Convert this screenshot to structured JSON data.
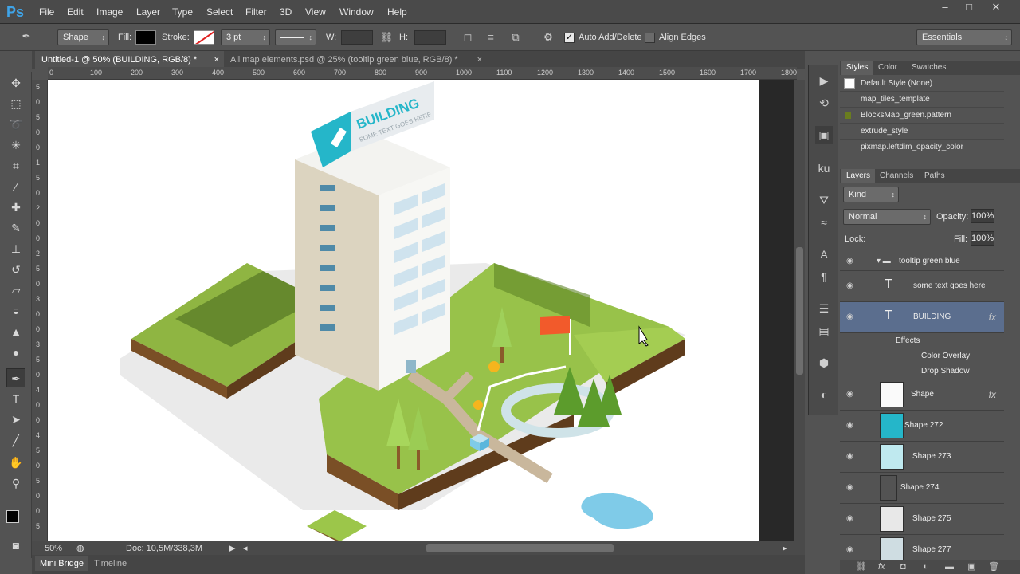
{
  "app": {
    "logo": "Ps"
  },
  "menu": [
    "File",
    "Edit",
    "Image",
    "Layer",
    "Type",
    "Select",
    "Filter",
    "3D",
    "View",
    "Window",
    "Help"
  ],
  "window_buttons": [
    "–",
    "□",
    "✕"
  ],
  "options": {
    "mode": "Shape",
    "fill_label": "Fill:",
    "stroke_label": "Stroke:",
    "stroke_size": "3 pt",
    "w_label": "W:",
    "h_label": "H:",
    "auto_add": "Auto Add/Delete",
    "align_edges": "Align Edges",
    "workspace": "Essentials"
  },
  "tabs": [
    {
      "label": "Untitled-1 @ 50% (BUILDING, RGB/8) *"
    },
    {
      "label": "All map elements.psd @ 25% (tooltip green blue, RGB/8) *"
    }
  ],
  "ruler": {
    "h": [
      "0",
      "100",
      "200",
      "300",
      "400",
      "500",
      "600",
      "700",
      "800",
      "900",
      "1000",
      "1100",
      "1200",
      "1300",
      "1400",
      "1500",
      "1600",
      "1700",
      "1800"
    ],
    "v": [
      "5",
      "0",
      "5",
      "0",
      "0",
      "1",
      "5",
      "0",
      "2",
      "0",
      "0",
      "2",
      "5",
      "0",
      "3",
      "0",
      "0",
      "3",
      "5",
      "0",
      "4",
      "0",
      "0",
      "4",
      "5",
      "0",
      "5",
      "0",
      "0",
      "5"
    ]
  },
  "canvas": {
    "title": "BUILDING",
    "subtitle": "SOME TEXT GOES HERE"
  },
  "status": {
    "zoom": "50%",
    "doc": "Doc: 10,5M/338,3M"
  },
  "bottom_tabs": [
    "Mini Bridge",
    "Timeline"
  ],
  "styles_panel": {
    "tabs": [
      "Styles",
      "Color",
      "Swatches"
    ],
    "items": [
      "Default Style (None)",
      "map_tiles_template",
      "BlocksMap_green.pattern",
      "extrude_style",
      "pixmap.leftdim_opacity_color"
    ]
  },
  "layers_panel": {
    "tabs": [
      "Layers",
      "Channels",
      "Paths"
    ],
    "kind": "Kind",
    "blend": "Normal",
    "opacity_label": "Opacity:",
    "opacity": "100%",
    "lock_label": "Lock:",
    "fill_label": "Fill:",
    "fill": "100%",
    "group": "tooltip green blue",
    "text1": "some text goes here",
    "text2": "BUILDING",
    "effects": "Effects",
    "effect1": "Color Overlay",
    "effect2": "Drop Shadow",
    "shapes": [
      "Shape",
      "Shape 272",
      "Shape 273",
      "Shape 274",
      "Shape 275",
      "Shape 277"
    ]
  },
  "colors": {
    "accent": "#3fa4e8",
    "teal": "#25b6c9",
    "grass": "#8db43a",
    "dirt": "#8a5a2a",
    "flag": "#f25a2b",
    "water": "#7fcbe8"
  }
}
